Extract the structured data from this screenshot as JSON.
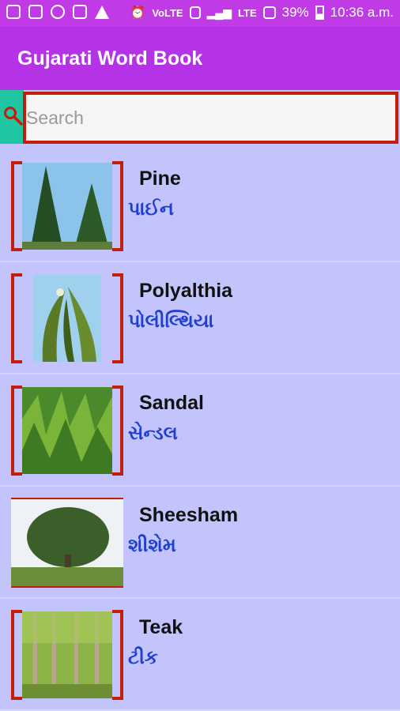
{
  "status_bar": {
    "left_icons": [
      "message-icon",
      "image-icon",
      "sync-icon",
      "mail-icon",
      "warning-icon"
    ],
    "volte": "VoLTE",
    "lte": "LTE",
    "battery": "39%",
    "time": "10:36 a.m."
  },
  "app_bar": {
    "title": "Gujarati Word Book"
  },
  "search": {
    "placeholder": "Search",
    "value": ""
  },
  "items": [
    {
      "english": "Pine",
      "gujarati": "પાઈન",
      "image": "pine-trees"
    },
    {
      "english": "Polyalthia",
      "gujarati": "પોલીલ્થિયા",
      "image": "polyalthia-leaves"
    },
    {
      "english": "Sandal",
      "gujarati": "સેન્ડલ",
      "image": "sandal-plants"
    },
    {
      "english": "Sheesham",
      "gujarati": "શીશેમ",
      "image": "sheesham-tree"
    },
    {
      "english": "Teak",
      "gujarati": "ટીક",
      "image": "teak-forest"
    }
  ],
  "colors": {
    "status_bar": "#c03be6",
    "app_bar": "#b533e6",
    "list_background": "#c2c4fb",
    "frame_red": "#c21e0c",
    "accent_teal": "#1fc6a1",
    "gujarati_text": "#1e3fcf"
  }
}
